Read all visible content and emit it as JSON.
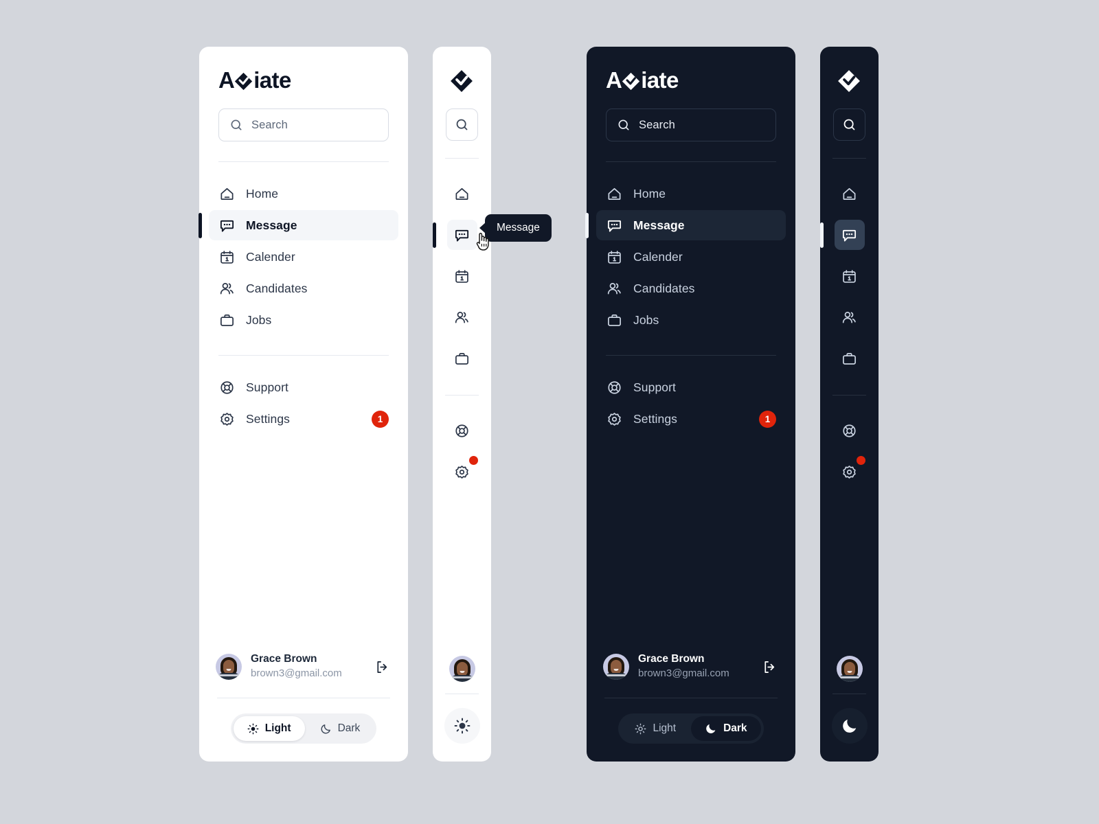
{
  "brand": {
    "name": "Aviate",
    "wordmark_prefix": "A",
    "wordmark_suffix": "iate",
    "logo_icon": "diamond-check-logo"
  },
  "search": {
    "placeholder": "Search",
    "icon": "search-icon"
  },
  "nav": {
    "primary": [
      {
        "id": "home",
        "label": "Home",
        "icon": "home-icon",
        "active": false,
        "badge": null
      },
      {
        "id": "message",
        "label": "Message",
        "icon": "message-icon",
        "active": true,
        "badge": null
      },
      {
        "id": "calender",
        "label": "Calender",
        "icon": "calendar-icon",
        "active": false,
        "badge": null
      },
      {
        "id": "candidates",
        "label": "Candidates",
        "icon": "users-icon",
        "active": false,
        "badge": null
      },
      {
        "id": "jobs",
        "label": "Jobs",
        "icon": "briefcase-icon",
        "active": false,
        "badge": null
      }
    ],
    "secondary": [
      {
        "id": "support",
        "label": "Support",
        "icon": "lifebuoy-icon",
        "active": false,
        "badge": null
      },
      {
        "id": "settings",
        "label": "Settings",
        "icon": "gear-icon",
        "active": false,
        "badge": "1"
      }
    ]
  },
  "tooltip": {
    "label": "Message"
  },
  "profile": {
    "name": "Grace Brown",
    "email": "brown3@gmail.com",
    "avatar_alt": "Grace Brown avatar",
    "logout_icon": "logout-icon"
  },
  "theme_toggle": {
    "light_label": "Light",
    "dark_label": "Dark",
    "light_icon": "sun-icon",
    "dark_icon": "moon-icon",
    "light_panel_selected": "Light",
    "dark_panel_selected": "Dark"
  },
  "colors": {
    "badge_red": "#e0240b",
    "dark_bg": "#111827",
    "light_bg": "#ffffff",
    "page_bg": "#d3d6dc",
    "active_light_bg": "#f4f6f9",
    "active_dark_bg": "#1c2636"
  }
}
